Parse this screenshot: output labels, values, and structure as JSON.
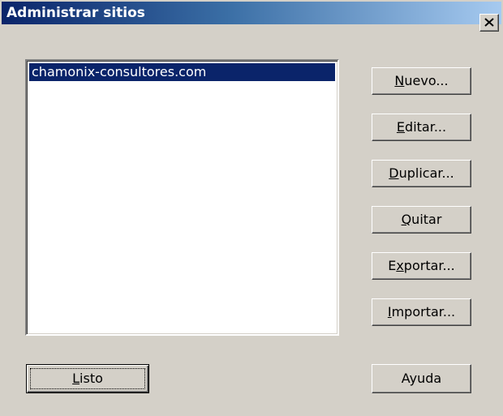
{
  "window": {
    "title": "Administrar sitios",
    "close_icon": "close-icon"
  },
  "sites": {
    "items": [
      {
        "label": "chamonix-consultores.com",
        "selected": true
      }
    ]
  },
  "buttons": {
    "new": {
      "mnemonic": "N",
      "rest": "uevo..."
    },
    "edit": {
      "mnemonic": "E",
      "rest": "ditar..."
    },
    "duplicate": {
      "mnemonic": "D",
      "rest": "uplicar..."
    },
    "remove": {
      "mnemonic": "Q",
      "rest": "uitar"
    },
    "export": {
      "pre": "E",
      "mnemonic": "x",
      "rest": "portar..."
    },
    "import": {
      "mnemonic": "I",
      "rest": "mportar..."
    },
    "done": {
      "mnemonic": "L",
      "rest": "isto"
    },
    "help": {
      "label": "Ayuda"
    }
  },
  "colors": {
    "title_start": "#0a246a",
    "title_end": "#a6caf0",
    "selection": "#0a246a",
    "face": "#d4d0c8"
  }
}
